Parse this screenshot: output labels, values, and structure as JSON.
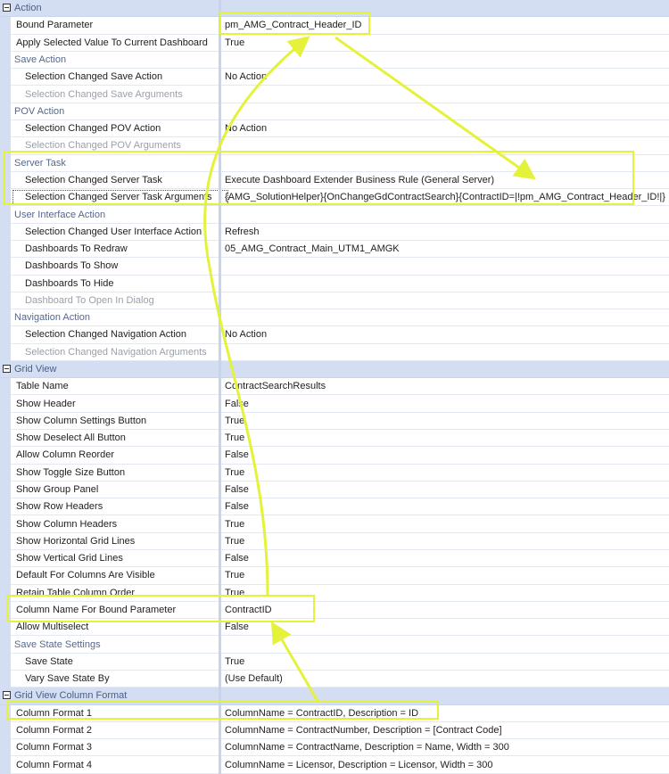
{
  "accent_color": "#e4f23a",
  "rows": [
    {
      "type": "cat",
      "name": "Action"
    },
    {
      "type": "l1",
      "name": "Bound Parameter",
      "value": "pm_AMG_Contract_Header_ID"
    },
    {
      "type": "l1",
      "name": "Apply Selected Value To Current Dashboard",
      "value": "True"
    },
    {
      "type": "sub",
      "name": "Save Action"
    },
    {
      "type": "l2",
      "name": "Selection Changed Save Action",
      "value": "No Action"
    },
    {
      "type": "l2dis",
      "name": "Selection Changed Save Arguments"
    },
    {
      "type": "sub",
      "name": "POV Action"
    },
    {
      "type": "l2",
      "name": "Selection Changed POV Action",
      "value": "No Action"
    },
    {
      "type": "l2dis",
      "name": "Selection Changed POV Arguments"
    },
    {
      "type": "sub",
      "name": "Server Task"
    },
    {
      "type": "l2",
      "name": "Selection Changed Server Task",
      "value": "Execute Dashboard Extender Business Rule (General Server)"
    },
    {
      "type": "l2focus",
      "name": "Selection Changed Server Task Arguments",
      "value": "{AMG_SolutionHelper}{OnChangeGdContractSearch}{ContractID=|!pm_AMG_Contract_Header_ID!|}"
    },
    {
      "type": "sub",
      "name": "User Interface Action"
    },
    {
      "type": "l2",
      "name": "Selection Changed User Interface Action",
      "value": "Refresh"
    },
    {
      "type": "l2",
      "name": "Dashboards To Redraw",
      "value": "05_AMG_Contract_Main_UTM1_AMGK"
    },
    {
      "type": "l2",
      "name": "Dashboards To Show"
    },
    {
      "type": "l2",
      "name": "Dashboards To Hide"
    },
    {
      "type": "l2dis",
      "name": "Dashboard To Open In Dialog"
    },
    {
      "type": "sub",
      "name": "Navigation Action"
    },
    {
      "type": "l2",
      "name": "Selection Changed Navigation Action",
      "value": "No Action"
    },
    {
      "type": "l2dis",
      "name": "Selection Changed Navigation Arguments"
    },
    {
      "type": "cat",
      "name": "Grid View"
    },
    {
      "type": "l1",
      "name": "Table Name",
      "value": "ContractSearchResults"
    },
    {
      "type": "l1",
      "name": "Show Header",
      "value": "False"
    },
    {
      "type": "l1",
      "name": "Show Column Settings Button",
      "value": "True"
    },
    {
      "type": "l1",
      "name": "Show Deselect All Button",
      "value": "True"
    },
    {
      "type": "l1",
      "name": "Allow Column Reorder",
      "value": "False"
    },
    {
      "type": "l1",
      "name": "Show Toggle Size Button",
      "value": "True"
    },
    {
      "type": "l1",
      "name": "Show Group Panel",
      "value": "False"
    },
    {
      "type": "l1",
      "name": "Show Row Headers",
      "value": "False"
    },
    {
      "type": "l1",
      "name": "Show Column Headers",
      "value": "True"
    },
    {
      "type": "l1",
      "name": "Show Horizontal Grid Lines",
      "value": "True"
    },
    {
      "type": "l1",
      "name": "Show Vertical Grid Lines",
      "value": "False"
    },
    {
      "type": "l1",
      "name": "Default For Columns Are Visible",
      "value": "True"
    },
    {
      "type": "l1",
      "name": "Retain Table Column Order",
      "value": "True"
    },
    {
      "type": "l1",
      "name": "Column Name For Bound Parameter",
      "value": "ContractID"
    },
    {
      "type": "l1",
      "name": "Allow Multiselect",
      "value": "False"
    },
    {
      "type": "sub",
      "name": "Save State Settings"
    },
    {
      "type": "l2",
      "name": "Save State",
      "value": "True"
    },
    {
      "type": "l2",
      "name": "Vary Save State By",
      "value": "(Use Default)"
    },
    {
      "type": "cat",
      "name": "Grid View Column Format"
    },
    {
      "type": "l1",
      "name": "Column Format 1",
      "value": "ColumnName = ContractID, Description = ID"
    },
    {
      "type": "l1",
      "name": "Column Format 2",
      "value": "ColumnName = ContractNumber, Description = [Contract Code]"
    },
    {
      "type": "l1",
      "name": "Column Format 3",
      "value": "ColumnName = ContractName, Description = Name, Width = 300"
    },
    {
      "type": "l1",
      "name": "Column Format 4",
      "value": "ColumnName = Licensor, Description = Licensor, Width = 300"
    }
  ]
}
